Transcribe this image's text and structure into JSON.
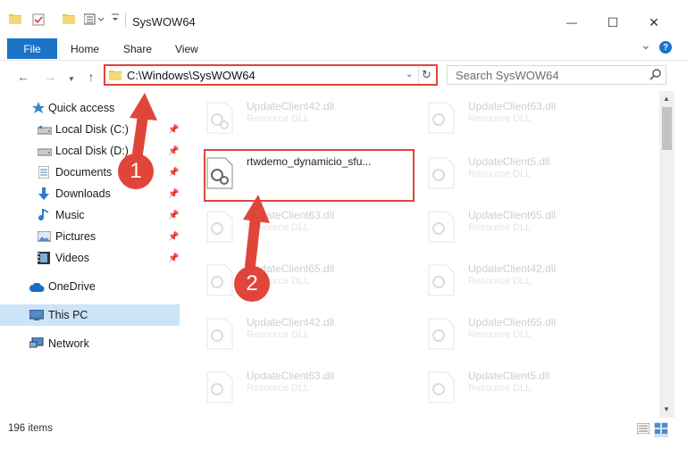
{
  "window": {
    "title": "SysWOW64",
    "minimize_glyph": "—",
    "maximize_glyph": "☐",
    "close_glyph": "✕"
  },
  "ribbon": {
    "tabs": [
      "File",
      "Home",
      "Share",
      "View"
    ],
    "expand_glyph": "⌄",
    "help_glyph": "?"
  },
  "address": {
    "path": "C:\\Windows\\SysWOW64",
    "search_placeholder": "Search SysWOW64"
  },
  "nav": {
    "items": [
      {
        "label": "Quick access",
        "icon": "star-icon"
      },
      {
        "label": "Local Disk (C:)",
        "icon": "drive-icon",
        "pinned": true
      },
      {
        "label": "Local Disk (D:)",
        "icon": "drive-icon",
        "pinned": true
      },
      {
        "label": "Documents",
        "icon": "documents-icon",
        "pinned": true
      },
      {
        "label": "Downloads",
        "icon": "downloads-icon",
        "pinned": true
      },
      {
        "label": "Music",
        "icon": "music-icon",
        "pinned": true
      },
      {
        "label": "Pictures",
        "icon": "pictures-icon",
        "pinned": true
      },
      {
        "label": "Videos",
        "icon": "videos-icon",
        "pinned": true
      },
      {
        "label": "OneDrive",
        "icon": "onedrive-icon"
      },
      {
        "label": "This PC",
        "icon": "this-pc-icon",
        "selected": true
      },
      {
        "label": "Network",
        "icon": "network-icon"
      }
    ]
  },
  "files": [
    {
      "name": "UpdateClient42.dll",
      "type": "Resource DLL",
      "faded": true
    },
    {
      "name": "UpdateClient63.dll",
      "type": "Resource DLL",
      "faded": true
    },
    {
      "name": "rtwdemo_dynamicio_sfu...",
      "type": "",
      "faded": false,
      "highlighted": true
    },
    {
      "name": "UpdateClient5.dll",
      "type": "Resource DLL",
      "faded": true
    },
    {
      "name": "UpdateClient63.dll",
      "type": "Resource DLL",
      "faded": true
    },
    {
      "name": "UpdateClient65.dll",
      "type": "Resource DLL",
      "faded": true
    },
    {
      "name": "UpdateClient65.dll",
      "type": "Resource DLL",
      "faded": true
    },
    {
      "name": "UpdateClient42.dll",
      "type": "Resource DLL",
      "faded": true
    },
    {
      "name": "UpdateClient42.dll",
      "type": "Resource DLL",
      "faded": true
    },
    {
      "name": "UpdateClient65.dll",
      "type": "Resource DLL",
      "faded": true
    },
    {
      "name": "UpdateClient63.dll",
      "type": "Resource DLL",
      "faded": true
    },
    {
      "name": "UpdateClient5.dll",
      "type": "Resource DLL",
      "faded": true
    }
  ],
  "status": {
    "item_count": "196 items"
  },
  "annotations": {
    "step1": "1",
    "step2": "2"
  },
  "colors": {
    "accent": "#1a73c8",
    "annotation_red": "#e0453a",
    "selection": "#cce4f7"
  }
}
